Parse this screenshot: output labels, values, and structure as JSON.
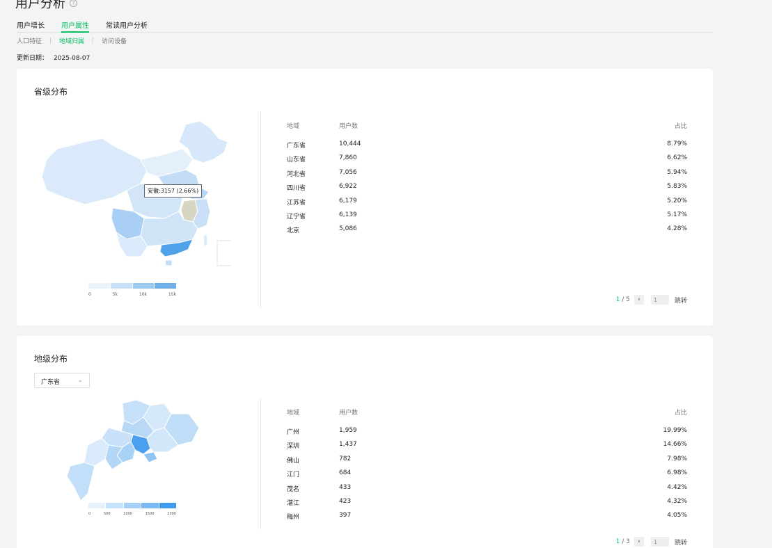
{
  "page_title": "用户分析",
  "tabs": [
    {
      "label": "用户增长"
    },
    {
      "label": "用户属性"
    },
    {
      "label": "常读用户分析"
    }
  ],
  "subtabs": [
    {
      "label": "人口特征"
    },
    {
      "label": "地域归属"
    },
    {
      "label": "访问设备"
    }
  ],
  "update": {
    "label": "更新日期：",
    "date": "2025-08-07"
  },
  "province": {
    "title": "省级分布",
    "tooltip": "安徽:3157 (2.66%)",
    "legend": {
      "ticks": [
        "0",
        "5k",
        "10k",
        "15k"
      ]
    },
    "columns": {
      "region": "地域",
      "users": "用户数",
      "pct": "占比"
    },
    "rows": [
      {
        "region": "广东省",
        "users": "10,444",
        "pct": "8.79%"
      },
      {
        "region": "山东省",
        "users": "7,860",
        "pct": "6.62%"
      },
      {
        "region": "河北省",
        "users": "7,056",
        "pct": "5.94%"
      },
      {
        "region": "四川省",
        "users": "6,922",
        "pct": "5.83%"
      },
      {
        "region": "江苏省",
        "users": "6,179",
        "pct": "5.20%"
      },
      {
        "region": "辽宁省",
        "users": "6,139",
        "pct": "5.17%"
      },
      {
        "region": "北京",
        "users": "5,086",
        "pct": "4.28%"
      }
    ],
    "pager": {
      "current": "1",
      "total": "/ 5",
      "input": "1",
      "jump": "跳转"
    }
  },
  "city": {
    "title": "地级分布",
    "select_value": "广东省",
    "legend": {
      "ticks": [
        "0",
        "500",
        "1000",
        "1500",
        "2000"
      ]
    },
    "columns": {
      "region": "地域",
      "users": "用户数",
      "pct": "占比"
    },
    "rows": [
      {
        "region": "广州",
        "users": "1,959",
        "pct": "19.99%"
      },
      {
        "region": "深圳",
        "users": "1,437",
        "pct": "14.66%"
      },
      {
        "region": "佛山",
        "users": "782",
        "pct": "7.98%"
      },
      {
        "region": "江门",
        "users": "684",
        "pct": "6.98%"
      },
      {
        "region": "茂名",
        "users": "433",
        "pct": "4.42%"
      },
      {
        "region": "湛江",
        "users": "423",
        "pct": "4.32%"
      },
      {
        "region": "梅州",
        "users": "397",
        "pct": "4.05%"
      }
    ],
    "pager": {
      "current": "1",
      "total": "/ 3",
      "input": "1",
      "jump": "跳转"
    }
  },
  "colors": {
    "accent": "#07c160",
    "map_light": "#dbeafa",
    "map_mid": "#a9cff4",
    "map_dark": "#4fa1ea",
    "map_highlight": "#d6d6c2"
  }
}
